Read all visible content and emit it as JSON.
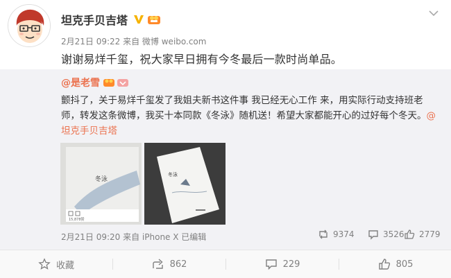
{
  "post": {
    "author": "坦克手贝吉塔",
    "meta": "2月21日 09:22 来自 微博 weibo.com",
    "text": "谢谢易烊千玺，祝大家早日拥有今冬最后一款时尚单品。"
  },
  "repost": {
    "author": "@是老雪",
    "text_before": "颤抖了，关于易烊千玺发了我姐夫新书这件事 我已经无心工作 来，用实际行动支持班老师，转发这条微博，我买十本同款《冬泳》随机送！希望大家都能开心的过好每个冬天。",
    "mention": "@坦克手贝吉塔",
    "meta": "2月21日 09:20 来自 iPhone X  已编辑",
    "stats": {
      "reposts": "9374",
      "comments": "3526",
      "likes": "2779"
    },
    "images": [
      {
        "book_title": "冬泳",
        "caption": "15,878赞"
      },
      {
        "book_title": "冬泳"
      }
    ]
  },
  "footer": {
    "favorite_label": "收藏",
    "repost_count": "862",
    "comment_count": "229",
    "like_count": "805"
  },
  "colors": {
    "accent": "#eb7350",
    "verified": "#f6b300",
    "repost_bg": "#f2f2f5",
    "meta_text": "#808080"
  }
}
